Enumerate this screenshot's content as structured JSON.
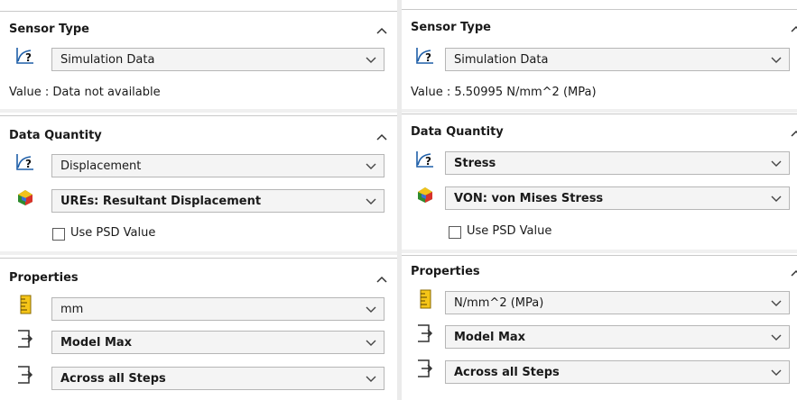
{
  "left": {
    "sensor_type": {
      "title": "Sensor Type",
      "selected": "Simulation Data",
      "value_text": "Value : Data not available"
    },
    "data_quantity": {
      "title": "Data Quantity",
      "quantity": "Displacement",
      "component": "UREs:  Resultant Displacement",
      "checkbox_label": "Use PSD Value",
      "checkbox_checked": false
    },
    "properties": {
      "title": "Properties",
      "unit": "mm",
      "criterion": "Model Max",
      "step_criterion": "Across all Steps"
    }
  },
  "right": {
    "sensor_type": {
      "title": "Sensor Type",
      "selected": "Simulation Data",
      "value_text": "Value : 5.50995 N/mm^2 (MPa)"
    },
    "data_quantity": {
      "title": "Data Quantity",
      "quantity": "Stress",
      "component": "VON: von Mises Stress",
      "checkbox_label": "Use PSD Value",
      "checkbox_checked": false
    },
    "properties": {
      "title": "Properties",
      "unit": "N/mm^2 (MPa)",
      "criterion": "Model Max",
      "step_criterion": "Across all Steps"
    }
  },
  "icons": {
    "sensor": "sensor-graph-icon",
    "result": "result-plot-icon",
    "unit": "ruler-icon",
    "criterion": "criteria-icon",
    "collapse": "chevron-up-icon",
    "dropdown": "chevron-down-icon"
  },
  "colors": {
    "panel_bg": "#ffffff",
    "dropdown_bg": "#f4f4f4",
    "separator": "#f0f0f0",
    "ruler_yellow": "#f5c518"
  }
}
